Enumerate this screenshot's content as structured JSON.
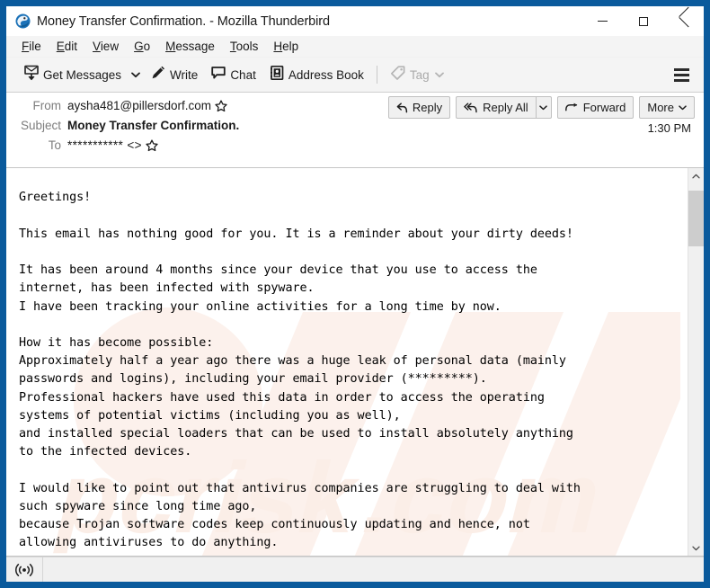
{
  "window": {
    "title": "Money Transfer Confirmation. - Mozilla Thunderbird",
    "app_icon": "thunderbird-icon",
    "controls": {
      "minimize": "Minimize",
      "maximize": "Maximize",
      "close": "Close"
    },
    "border_color": "#0a5a9c"
  },
  "menu": {
    "items": [
      {
        "label": "File",
        "accesskey": "F"
      },
      {
        "label": "Edit",
        "accesskey": "E"
      },
      {
        "label": "View",
        "accesskey": "V"
      },
      {
        "label": "Go",
        "accesskey": "G"
      },
      {
        "label": "Message",
        "accesskey": "M"
      },
      {
        "label": "Tools",
        "accesskey": "T"
      },
      {
        "label": "Help",
        "accesskey": "H"
      }
    ]
  },
  "toolbar": {
    "get_messages_label": "Get Messages",
    "write_label": "Write",
    "chat_label": "Chat",
    "address_book_label": "Address Book",
    "tag_label": "Tag",
    "tag_disabled": true,
    "app_menu_label": "Application Menu"
  },
  "message": {
    "from_label": "From",
    "from_value": "aysha481@pillersdorf.com",
    "subject_label": "Subject",
    "subject_value": "Money Transfer Confirmation.",
    "to_label": "To",
    "to_value": "***********  <>",
    "date": "1:30 PM",
    "actions": {
      "reply": "Reply",
      "reply_all": "Reply All",
      "forward": "Forward",
      "more": "More"
    },
    "body": "Greetings!\n\nThis email has nothing good for you. It is a reminder about your dirty deeds!\n\nIt has been around 4 months since your device that you use to access the\ninternet, has been infected with spyware.\nI have been tracking your online activities for a long time by now.\n\nHow it has become possible:\nApproximately half a year ago there was a huge leak of personal data (mainly\npasswords and logins), including your email provider (*********).\nProfessional hackers have used this data in order to access the operating\nsystems of potential victims (including you as well),\nand installed special loaders that can be used to install absolutely anything\nto the infected devices.\n\nI would like to point out that antivirus companies are struggling to deal with\nsuch spyware since long time ago,\nbecause Trojan software codes keep continuously updating and hence, not\nallowing antiviruses to do anything."
  },
  "scrollbar": {
    "up_arrow": "^",
    "down_arrow": "v"
  },
  "status_bar": {
    "online_icon": "online-status-icon",
    "text": ""
  },
  "watermark": {
    "text": "pcrisk.com",
    "color": "#fbf0ea"
  }
}
